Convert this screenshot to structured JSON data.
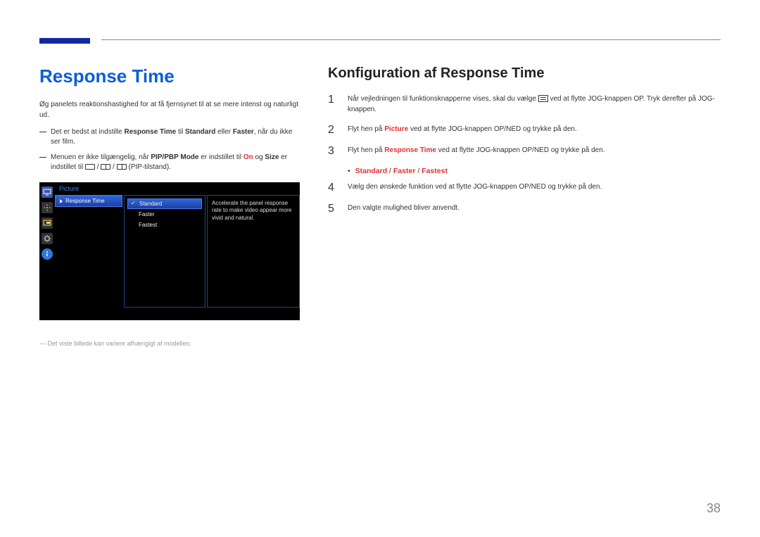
{
  "page_number": "38",
  "left": {
    "heading": "Response Time",
    "intro": "Øg panelets reaktionshastighed for at få fjernsynet til at se mere intenst og naturligt ud.",
    "note1_pre": "Det er bedst at indstille ",
    "note1_rt": "Response Time",
    "note1_mid": " til ",
    "note1_standard": "Standard",
    "note1_mid2": " eller ",
    "note1_faster": "Faster",
    "note1_post": ", når du ikke ser film.",
    "note2_pre": "Menuen er ikke tilgængelig, når ",
    "note2_pip": "PIP/PBP Mode",
    "note2_mid": " er indstillet til ",
    "note2_on": "On",
    "note2_mid2": " og ",
    "note2_size": "Size",
    "note2_mid3": " er indstillet til ",
    "note2_post": " (PIP-tilstand).",
    "footnote": "― Det viste billede kan variere afhængigt af modellen."
  },
  "osd": {
    "title": "Picture",
    "selected_item": "Response Time",
    "option1": "Standard",
    "option2": "Faster",
    "option3": "Fastest",
    "desc": "Accelerate the panel response rate to make video appear more vivid and natural."
  },
  "right": {
    "heading": "Konfiguration af Response Time",
    "step1_pre": "Når vejledningen til funktionsknapperne vises, skal du vælge ",
    "step1_post": " ved at flytte JOG-knappen OP. Tryk derefter på JOG-knappen.",
    "step2_pre": "Flyt hen på ",
    "step2_picture": "Picture",
    "step2_post": " ved at flytte JOG-knappen OP/NED og trykke på den.",
    "step3_pre": "Flyt hen på ",
    "step3_rt": "Response Time",
    "step3_post": " ved at flytte JOG-knappen OP/NED og trykke på den.",
    "options_standard": "Standard",
    "options_sep": " / ",
    "options_faster": "Faster",
    "options_fastest": "Fastest",
    "step4": "Vælg den ønskede funktion ved at flytte JOG-knappen OP/NED og trykke på den.",
    "step5": "Den valgte mulighed bliver anvendt."
  }
}
